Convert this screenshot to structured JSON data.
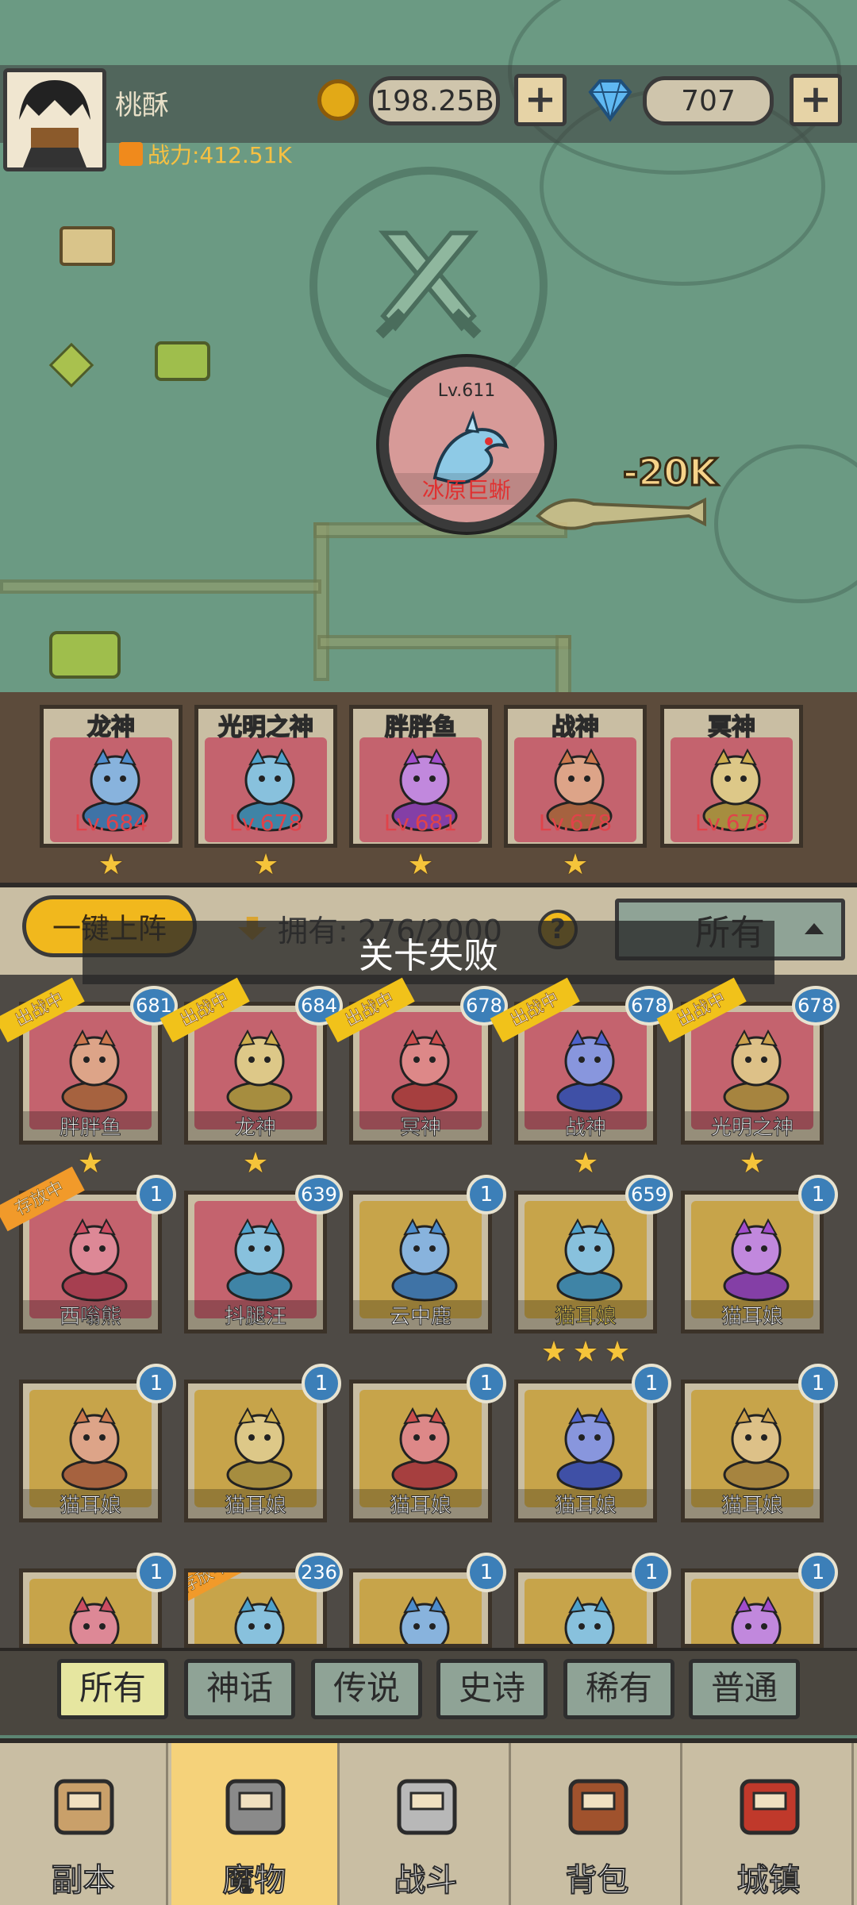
{
  "player": {
    "name": "桃酥",
    "power": "战力:412.51K",
    "coins": "198.25B",
    "gems": "707"
  },
  "boss": {
    "level": "Lv.611",
    "name": "冰原巨蜥",
    "damage": "-20K"
  },
  "team": [
    {
      "name": "龙神",
      "level": "Lv.684",
      "color": "#c4636e"
    },
    {
      "name": "光明之神",
      "level": "Lv.678",
      "color": "#c4636e"
    },
    {
      "name": "胖胖鱼",
      "level": "Lv.681",
      "color": "#c4636e"
    },
    {
      "name": "战神",
      "level": "Lv.678",
      "color": "#c4636e"
    },
    {
      "name": "冥神",
      "level": "Lv.678",
      "color": "#c4636e"
    }
  ],
  "controls": {
    "deploy": "一键上阵",
    "owned": "拥有: 276/2000",
    "filter": "所有",
    "toast": "关卡失败",
    "help": "?"
  },
  "roster": [
    {
      "name": "胖胖鱼",
      "level": "681",
      "tag": "出战中"
    },
    {
      "name": "龙神",
      "level": "684",
      "tag": "出战中"
    },
    {
      "name": "冥神",
      "level": "678",
      "tag": "出战中"
    },
    {
      "name": "战神",
      "level": "678",
      "tag": "出战中"
    },
    {
      "name": "光明之神",
      "level": "678",
      "tag": "出战中"
    },
    {
      "name": "西嗡熊",
      "level": "1",
      "tag": "存放中"
    },
    {
      "name": "抖腿汪",
      "level": "639",
      "tag": ""
    },
    {
      "name": "云中鹿",
      "level": "1",
      "tag": ""
    },
    {
      "name": "猫耳娘",
      "level": "659",
      "tag": ""
    },
    {
      "name": "猫耳娘",
      "level": "1",
      "tag": ""
    },
    {
      "name": "猫耳娘",
      "level": "1",
      "tag": ""
    },
    {
      "name": "猫耳娘",
      "level": "1",
      "tag": ""
    },
    {
      "name": "猫耳娘",
      "level": "1",
      "tag": ""
    },
    {
      "name": "猫耳娘",
      "level": "1",
      "tag": ""
    },
    {
      "name": "猫耳娘",
      "level": "1",
      "tag": ""
    },
    {
      "name": "",
      "level": "1",
      "tag": ""
    },
    {
      "name": "",
      "level": "236",
      "tag": "存放中"
    },
    {
      "name": "",
      "level": "1",
      "tag": ""
    },
    {
      "name": "",
      "level": "1",
      "tag": ""
    },
    {
      "name": "",
      "level": "1",
      "tag": ""
    }
  ],
  "rarityTabs": [
    "所有",
    "神话",
    "传说",
    "史诗",
    "稀有",
    "普通"
  ],
  "nav": [
    "副本",
    "魔物",
    "战斗",
    "背包",
    "城镇"
  ],
  "star": "★"
}
